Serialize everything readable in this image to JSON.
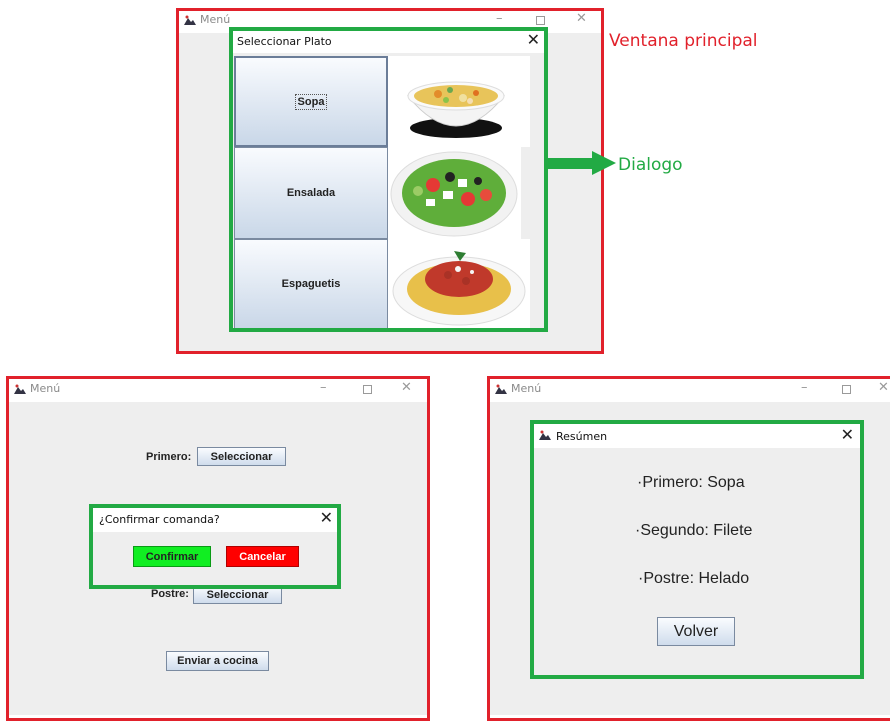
{
  "top_window": {
    "title": "Menú",
    "dialog": {
      "title": "Seleccionar Plato",
      "close": "✕",
      "dishes": [
        {
          "label": "Sopa",
          "image": "soup-bowl-image"
        },
        {
          "label": "Ensalada",
          "image": "salad-plate-image"
        },
        {
          "label": "Espaguetis",
          "image": "spaghetti-plate-image"
        }
      ]
    }
  },
  "annotations": {
    "main_window": "Ventana principal",
    "dialog": "Dialogo",
    "red": "#e1212b",
    "green": "#22aa44"
  },
  "left_window": {
    "title": "Menú",
    "primero_label": "Primero:",
    "primero_button": "Seleccionar",
    "postre_label": "Postre:",
    "postre_button": "Seleccionar",
    "send_button": "Enviar a cocina",
    "confirm_dialog": {
      "title": "¿Confirmar comanda?",
      "close": "✕",
      "confirm": "Confirmar",
      "cancel": "Cancelar",
      "confirm_color": "#11ee22",
      "cancel_color": "#ff0000"
    }
  },
  "right_window": {
    "title": "Menú",
    "summary_dialog": {
      "title": "Resúmen",
      "close": "✕",
      "primero": "·Primero: Sopa",
      "segundo": "·Segundo: Filete",
      "postre": "·Postre: Helado",
      "back": "Volver"
    }
  },
  "window_controls": {
    "minimize": "–",
    "close": "✕"
  }
}
